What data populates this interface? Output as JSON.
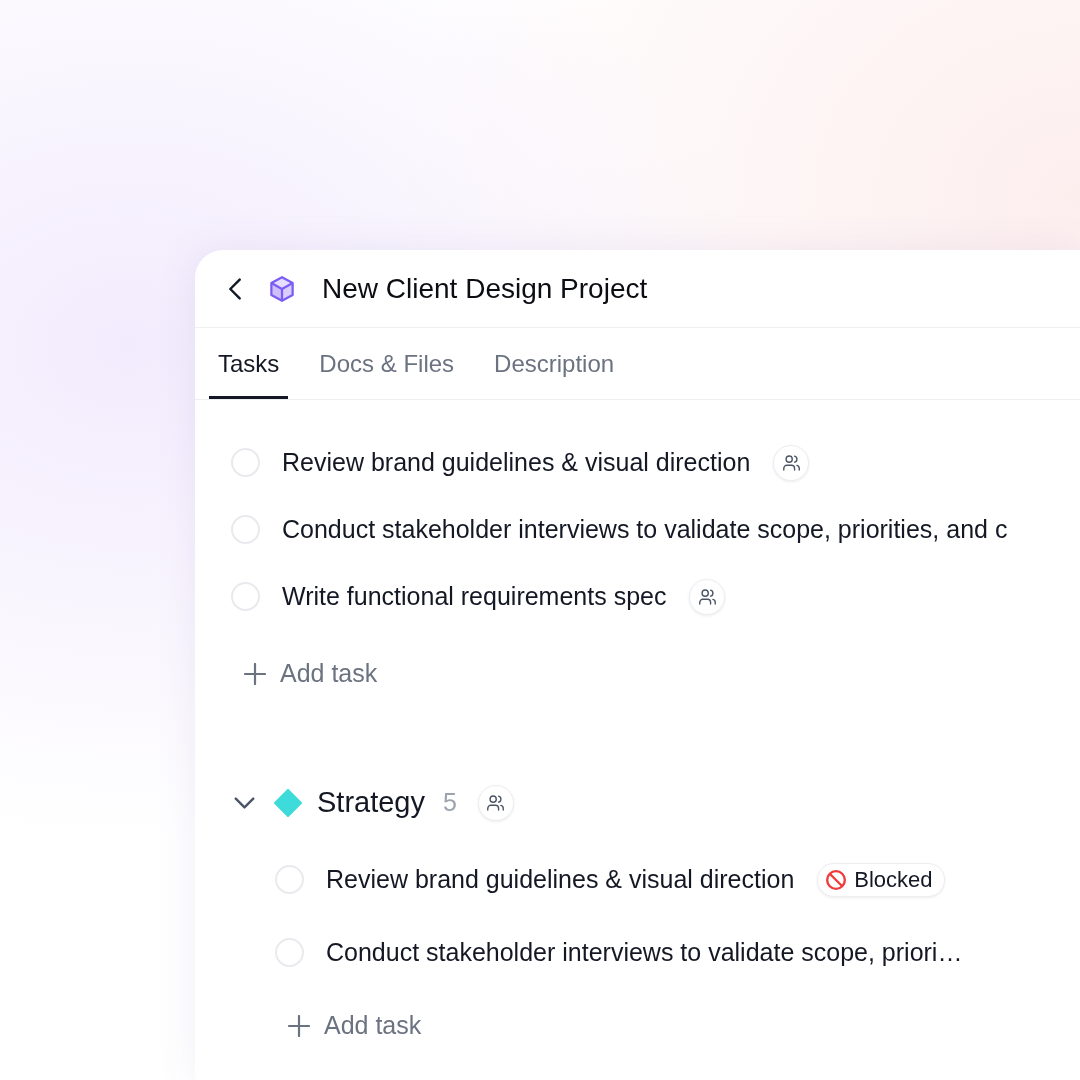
{
  "header": {
    "title": "New Client Design Project"
  },
  "tabs": [
    {
      "label": "Tasks",
      "selected": true
    },
    {
      "label": "Docs & Files",
      "selected": false
    },
    {
      "label": "Description",
      "selected": false
    }
  ],
  "tasks": [
    {
      "title": "Review brand guidelines & visual direction",
      "checked": false,
      "assignee_button": true
    },
    {
      "title": "Conduct stakeholder interviews to validate scope, priorities, and c",
      "checked": false
    },
    {
      "title": "Write functional requirements spec",
      "checked": false,
      "assignee_button": true
    }
  ],
  "add_task": "Add task",
  "groups": [
    {
      "name": "Strategy",
      "count": "5",
      "color": "#3ddbd9",
      "expanded": true,
      "assignee_button": true,
      "tasks": [
        {
          "title": "Review brand guidelines & visual direction",
          "checked": false,
          "status": {
            "kind": "blocked",
            "label": "Blocked"
          }
        },
        {
          "title": "Conduct stakeholder interviews to validate scope, priori…",
          "checked": false
        }
      ],
      "add_task": "Add task"
    }
  ]
}
